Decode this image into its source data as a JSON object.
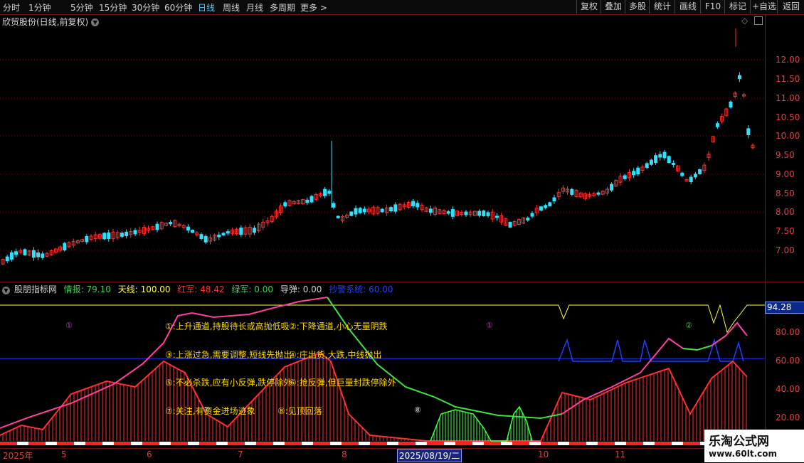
{
  "toolbar": {
    "left_items": [
      "分时",
      "1分钟",
      "5分钟",
      "15分钟",
      "30分钟",
      "60分钟",
      "日线",
      "周线",
      "月线",
      "多周期",
      "更多 >"
    ],
    "active_item": "日线",
    "right_items": [
      "复权",
      "叠加",
      "多股",
      "统计",
      "画线",
      "F10",
      "标记",
      "+自选",
      "返回"
    ]
  },
  "chart_title": "欣贸股份(日线,前复权)",
  "price_axis": [
    "12.00",
    "11.50",
    "11.00",
    "10.50",
    "10.00",
    "9.50",
    "9.00",
    "8.50",
    "8.00",
    "7.50",
    "7.00"
  ],
  "indicator": {
    "name": "股朋指标网",
    "readouts": [
      {
        "label": "情报: 79.10",
        "color": "#3fd04f"
      },
      {
        "label": "天线: 100.00",
        "color": "#ffff40"
      },
      {
        "label": "红军: 48.42",
        "color": "#ff3030"
      },
      {
        "label": "绿军: 0.00",
        "color": "#3fd04f"
      },
      {
        "label": "导弹: 0.00",
        "color": "#d0d0d0"
      },
      {
        "label": "抄警系统: 60.00",
        "color": "#2040ff"
      }
    ],
    "badge": "94.28",
    "axis": [
      "80.00",
      "60.00",
      "40.00",
      "20.00"
    ],
    "annotations": [
      "①:上升通道,持股待长或高抛低吸",
      "②:下降通道,小心无量阴跌",
      "③:上涨过急,需要调整,短线先抛出",
      "④:庄出货,大跌,中线抛出",
      "⑤:不必杀跌,应有小反弹,跌停除外",
      "⑥:抢反弹,但巨量封跌停除外",
      "⑦:关注,有资金进场迹象",
      "⑧:见顶回落"
    ],
    "markers": [
      "①",
      "①",
      "②",
      "⑧",
      "⑦"
    ]
  },
  "date_axis": [
    "2025年",
    "5",
    "6",
    "7",
    "8",
    "2025/08/19/二",
    "10",
    "11"
  ],
  "watermark": {
    "line1": "乐淘公式网",
    "line2": "www.60lt.com"
  },
  "colors": {
    "up": "#ff3030",
    "down": "#30e0ff",
    "grid": "#7a1010",
    "accent": "#4fd0ff"
  }
}
